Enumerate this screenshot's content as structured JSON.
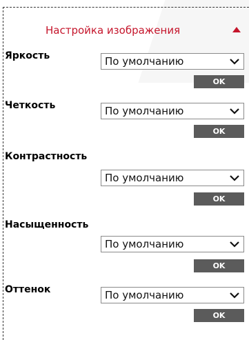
{
  "header": {
    "title": "Настройка изображения"
  },
  "settings": [
    {
      "label": "Яркость",
      "value": "По умолчанию",
      "ok_label": "OK"
    },
    {
      "label": "Четкость",
      "value": "По умолчанию",
      "ok_label": "OK"
    },
    {
      "label": "Контрастность",
      "value": "По умолчанию",
      "ok_label": "OK"
    },
    {
      "label": "Насыщенность",
      "value": "По умолчанию",
      "ok_label": "OK"
    },
    {
      "label": "Оттенок",
      "value": "По умолчанию",
      "ok_label": "OK"
    }
  ],
  "colors": {
    "accent": "#c5152b",
    "button_bg": "#5b5b5b"
  }
}
